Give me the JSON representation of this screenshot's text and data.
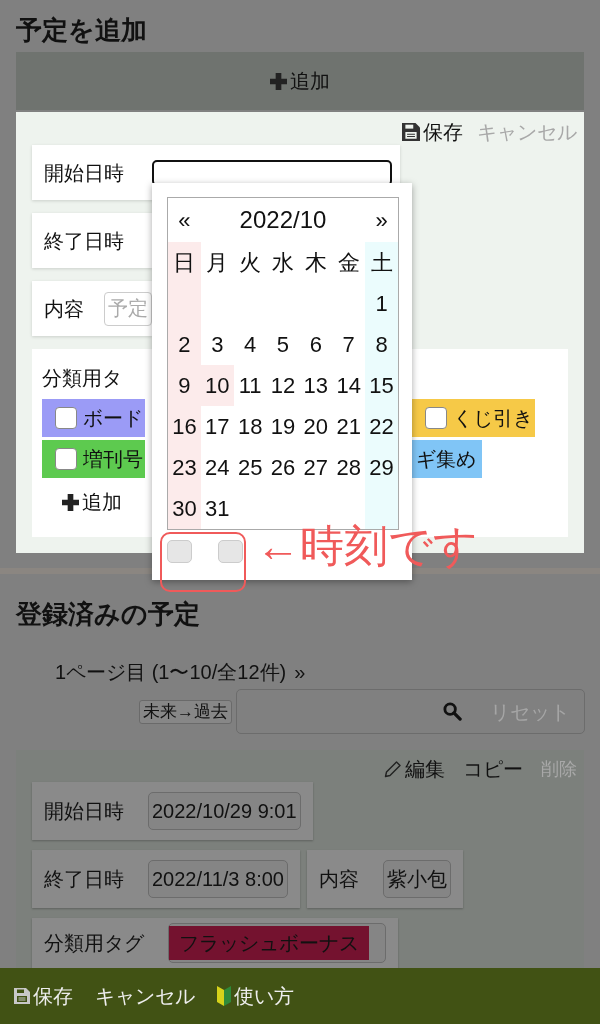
{
  "add_section": {
    "title": "予定を追加",
    "add_button": "追加"
  },
  "form": {
    "actions": [
      {
        "label": "保存",
        "kind": "save",
        "disabled": false
      },
      {
        "label": "キャンセル",
        "kind": "cancel",
        "disabled": true
      }
    ],
    "fields": [
      {
        "label": "開始日時",
        "kind": "input",
        "focused": true
      },
      {
        "label": "終了日時",
        "kind": "plain"
      },
      {
        "label": "内容",
        "kind": "input",
        "focused": false,
        "placeholder": "予定"
      }
    ],
    "tags": {
      "label": "分類用タ",
      "items": [
        {
          "text": "ボード",
          "color": "#9b9bf6",
          "checked": false
        },
        {
          "text": "くじ引き",
          "color": "#f6c947",
          "checked": false
        },
        {
          "text": "増刊号",
          "color": "#5dca4f",
          "checked": false
        },
        {
          "text": "ギ集め",
          "color": "#80c5f6"
        }
      ],
      "add_button": "追加"
    }
  },
  "calendar": {
    "prev": "«",
    "month": "2022/10",
    "next": "»",
    "weekdays": [
      "日",
      "月",
      "火",
      "水",
      "木",
      "金",
      "土"
    ],
    "weeks": [
      [
        {
          "day": "1",
          "holiday": false
        }
      ],
      [
        {
          "day": "2"
        },
        {
          "day": "3",
          "holiday": false
        },
        {
          "day": "4",
          "holiday": false
        },
        {
          "day": "5",
          "holiday": false
        },
        {
          "day": "6",
          "holiday": false
        },
        {
          "day": "7",
          "holiday": false
        },
        {
          "day": "8",
          "holiday": false
        }
      ],
      [
        {
          "day": "9"
        },
        {
          "day": "10",
          "holiday": true
        },
        {
          "day": "11",
          "holiday": false
        },
        {
          "day": "12",
          "holiday": false
        },
        {
          "day": "13",
          "holiday": false
        },
        {
          "day": "14",
          "holiday": false
        },
        {
          "day": "15",
          "holiday": false
        }
      ],
      [
        {
          "day": "16"
        },
        {
          "day": "17",
          "holiday": false
        },
        {
          "day": "18",
          "holiday": false
        },
        {
          "day": "19",
          "holiday": false
        },
        {
          "day": "20",
          "holiday": false
        },
        {
          "day": "21",
          "holiday": false
        },
        {
          "day": "22",
          "holiday": false
        }
      ],
      [
        {
          "day": "23"
        },
        {
          "day": "24",
          "holiday": false
        },
        {
          "day": "25",
          "holiday": false
        },
        {
          "day": "26",
          "holiday": false
        },
        {
          "day": "27",
          "holiday": false
        },
        {
          "day": "28",
          "holiday": false
        },
        {
          "day": "29",
          "holiday": false
        }
      ],
      [
        {
          "day": "30"
        },
        {
          "day": "31",
          "holiday": false
        }
      ]
    ],
    "time_fields": [
      {
        "disabled": true
      },
      {
        "disabled": true
      }
    ]
  },
  "annotation": {
    "text": "←時刻です"
  },
  "registered": {
    "title": "登録済みの予定",
    "pager": {
      "text": "1ページ目 (1〜10/全12件)",
      "next": "»"
    },
    "sort_button": "未来→過去",
    "search": {
      "reset": "リセット"
    },
    "event": {
      "actions": [
        {
          "label": "編集",
          "kind": "edit",
          "disabled": false
        },
        {
          "label": "コピー",
          "kind": "copy",
          "disabled": false
        },
        {
          "label": "削除",
          "kind": "delete",
          "disabled": true
        }
      ],
      "rows": [
        [
          {
            "label": "開始日時",
            "value": "2022/10/29 9:01"
          }
        ],
        [
          {
            "label": "終了日時",
            "value": "2022/11/3 8:00"
          },
          {
            "label": "内容",
            "value": "紫小包"
          }
        ],
        [
          {
            "label": "分類用タグ",
            "tag": {
              "text": "フラッシュボーナス",
              "color": "#74122f"
            }
          }
        ]
      ]
    }
  },
  "footer": [
    {
      "label": "保存",
      "kind": "save"
    },
    {
      "label": "キャンセル",
      "kind": "cancel"
    },
    {
      "label": "使い方",
      "kind": "help"
    }
  ]
}
